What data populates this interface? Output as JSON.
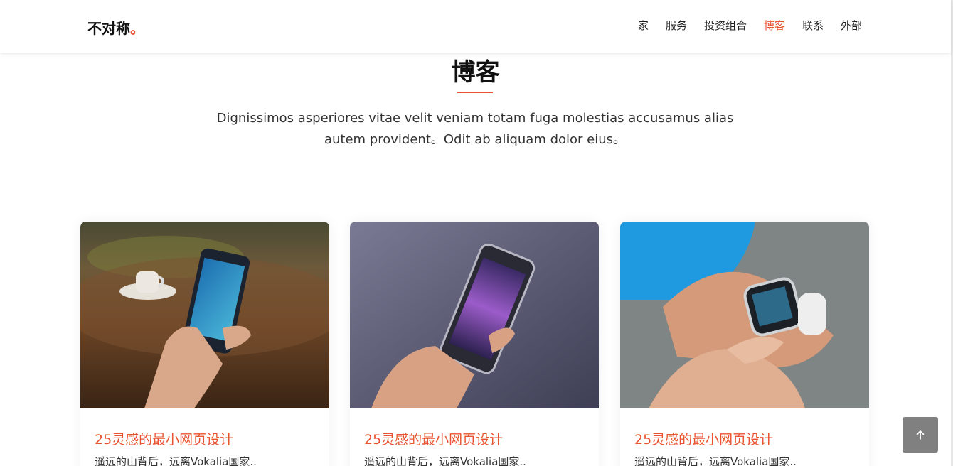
{
  "header": {
    "logo_text": "不对称",
    "logo_dot": "。",
    "nav": [
      {
        "label": "家",
        "active": false
      },
      {
        "label": "服务",
        "active": false
      },
      {
        "label": "投资组合",
        "active": false
      },
      {
        "label": "博客",
        "active": true
      },
      {
        "label": "联系",
        "active": false
      },
      {
        "label": "外部",
        "active": false
      }
    ]
  },
  "section": {
    "title": "博客",
    "description": "Dignissimos asperiores vitae velit veniam totam fuga molestias accusamus alias autem provident。Odit ab aliquam dolor eius。"
  },
  "posts": [
    {
      "title": "25灵感的最小网页设计",
      "excerpt": "遥远的山背后，远离Vokalia国家.."
    },
    {
      "title": "25灵感的最小网页设计",
      "excerpt": "遥远的山背后，远离Vokalia国家.."
    },
    {
      "title": "25灵感的最小网页设计",
      "excerpt": "遥远的山背后，远离Vokalia国家.."
    }
  ],
  "back_to_top": {
    "icon": "arrow-up-icon"
  },
  "colors": {
    "accent": "#e9532f",
    "back_to_top_bg": "#808080"
  }
}
